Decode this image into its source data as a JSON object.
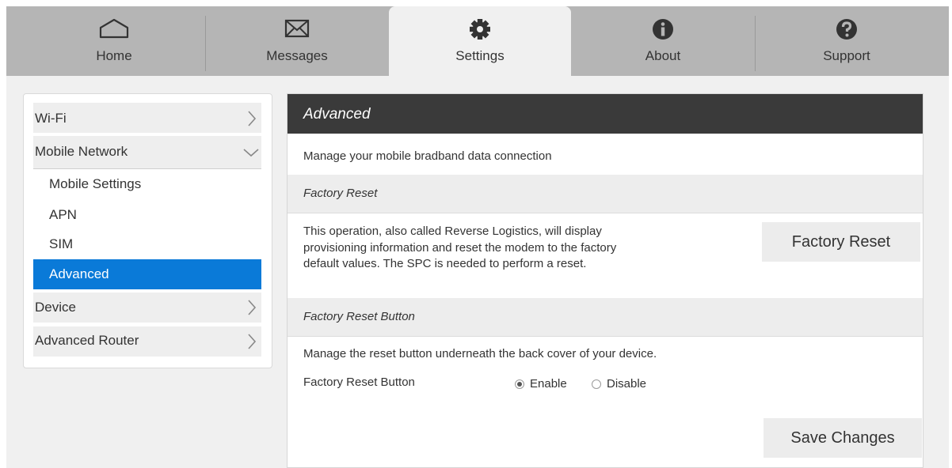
{
  "nav": {
    "tabs": [
      {
        "label": "Home",
        "icon": "home-icon"
      },
      {
        "label": "Messages",
        "icon": "envelope-icon"
      },
      {
        "label": "Settings",
        "icon": "gear-icon",
        "active": true
      },
      {
        "label": "About",
        "icon": "info-icon"
      },
      {
        "label": "Support",
        "icon": "question-icon"
      }
    ]
  },
  "sidebar": {
    "items": [
      {
        "label": "Wi-Fi",
        "icon": "chevron-right-icon"
      },
      {
        "label": "Mobile Network",
        "icon": "chevron-down-icon",
        "expanded": true
      },
      {
        "label": "Device",
        "icon": "chevron-right-icon"
      },
      {
        "label": "Advanced Router",
        "icon": "chevron-right-icon"
      }
    ],
    "subitems": [
      {
        "label": "Mobile Settings"
      },
      {
        "label": "APN"
      },
      {
        "label": "SIM"
      },
      {
        "label": "Advanced",
        "active": true
      }
    ]
  },
  "panel": {
    "title": "Advanced",
    "intro": "Manage your mobile bradband data connection",
    "factory_reset": {
      "heading": "Factory Reset",
      "description_lines": [
        "This operation, also called Reverse Logistics, will display",
        "provisioning information and reset the modem to the factory",
        "default values. The SPC is needed to perform a reset."
      ],
      "button_label": "Factory Reset"
    },
    "reset_button": {
      "heading": "Factory Reset Button",
      "description": "Manage the reset button underneath the back cover of your device.",
      "field_label": "Factory Reset Button",
      "options": [
        "Enable",
        "Disable"
      ],
      "selected": "Enable"
    },
    "save_label": "Save Changes"
  },
  "colors": {
    "nav_bg": "#b5b5b5",
    "page_bg": "#f0f0f0",
    "panel_header": "#3a3a3a",
    "accent": "#0a7ad8"
  }
}
